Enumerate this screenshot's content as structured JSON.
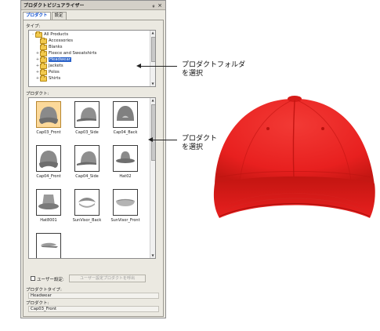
{
  "panel": {
    "title": "プロダクトビジュアライザー",
    "pin_glyph": "ᵩ",
    "close_glyph": "×",
    "tabs": [
      {
        "label": "プロダクト",
        "active": true
      },
      {
        "label": "設定",
        "active": false
      }
    ]
  },
  "type_section": {
    "label": "タイプ:",
    "tree": [
      {
        "label": "All Products",
        "expander": "-",
        "level": 0,
        "selected": false
      },
      {
        "label": "Accessories",
        "expander": "",
        "level": 1,
        "selected": false
      },
      {
        "label": "Blanks",
        "expander": "",
        "level": 1,
        "selected": false
      },
      {
        "label": "Fleece and Sweatshirts",
        "expander": "+",
        "level": 1,
        "selected": false
      },
      {
        "label": "Headwear",
        "expander": "+",
        "level": 1,
        "selected": true
      },
      {
        "label": "Jackets",
        "expander": "+",
        "level": 1,
        "selected": false
      },
      {
        "label": "Polos",
        "expander": "+",
        "level": 1,
        "selected": false
      },
      {
        "label": "Shirts",
        "expander": "+",
        "level": 1,
        "selected": false
      }
    ]
  },
  "product_section": {
    "label": "プロダクト:",
    "items": [
      {
        "caption": "Cap03_Front",
        "shape": "cap-front",
        "selected": true
      },
      {
        "caption": "Cap03_Side",
        "shape": "cap-side",
        "selected": false
      },
      {
        "caption": "Cap04_Back",
        "shape": "cap-back",
        "selected": false
      },
      {
        "caption": "Cap04_Front",
        "shape": "cap-front",
        "selected": false
      },
      {
        "caption": "Cap04_Side",
        "shape": "cap-side",
        "selected": false
      },
      {
        "caption": "Hat02",
        "shape": "hat",
        "selected": false
      },
      {
        "caption": "Hat8001",
        "shape": "bucket",
        "selected": false
      },
      {
        "caption": "SunVisor_Back",
        "shape": "visor-back",
        "selected": false
      },
      {
        "caption": "SunVisor_Front",
        "shape": "visor-front",
        "selected": false
      },
      {
        "caption": "",
        "shape": "visor-side",
        "selected": false
      }
    ]
  },
  "custom": {
    "checkbox_label": "ユーザー設定:",
    "checked": false,
    "button_label": "ユーザー設定プロダクトを呼出"
  },
  "product_type": {
    "label": "プロダクトタイプ:",
    "value": "Headwear"
  },
  "product": {
    "label": "プロダクト:",
    "value": "Cap03_Front"
  },
  "callouts": {
    "folder_line1": "プロダクトフォルダ",
    "folder_line2": "を選択",
    "product_line1": "プロダクト",
    "product_line2": "を選択"
  },
  "preview": {
    "subject": "red baseball cap",
    "color": "#e8201f",
    "shadow_color": "#b8120f"
  },
  "colors": {
    "selection_blue": "#2a62c9",
    "thumb_selected": "#fcd99a",
    "panel_bg": "#ebe9e1"
  }
}
